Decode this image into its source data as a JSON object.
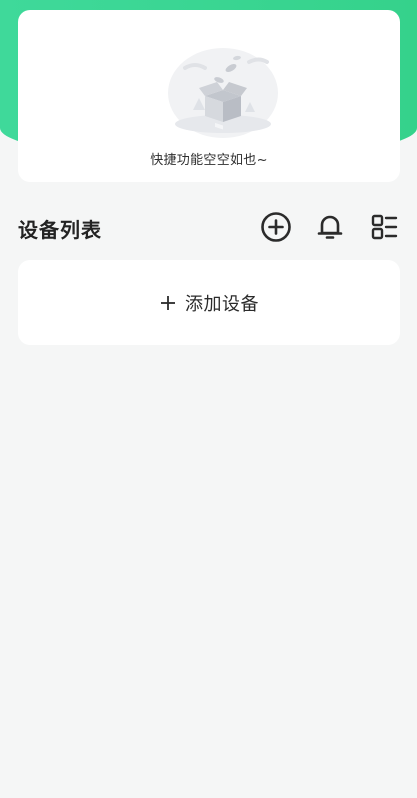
{
  "quick_functions": {
    "empty_text": "快捷功能空空如也~",
    "illustration_icon": "empty-box-icon"
  },
  "device_list": {
    "title": "设备列表",
    "add_icon": "circle-plus-icon",
    "bell_icon": "bell-icon",
    "list_icon": "list-view-icon",
    "add_device_label": "添加设备"
  },
  "colors": {
    "header_green": "#3fd99a",
    "background": "#f5f6f6",
    "card": "#ffffff",
    "text_dark": "#232323"
  }
}
